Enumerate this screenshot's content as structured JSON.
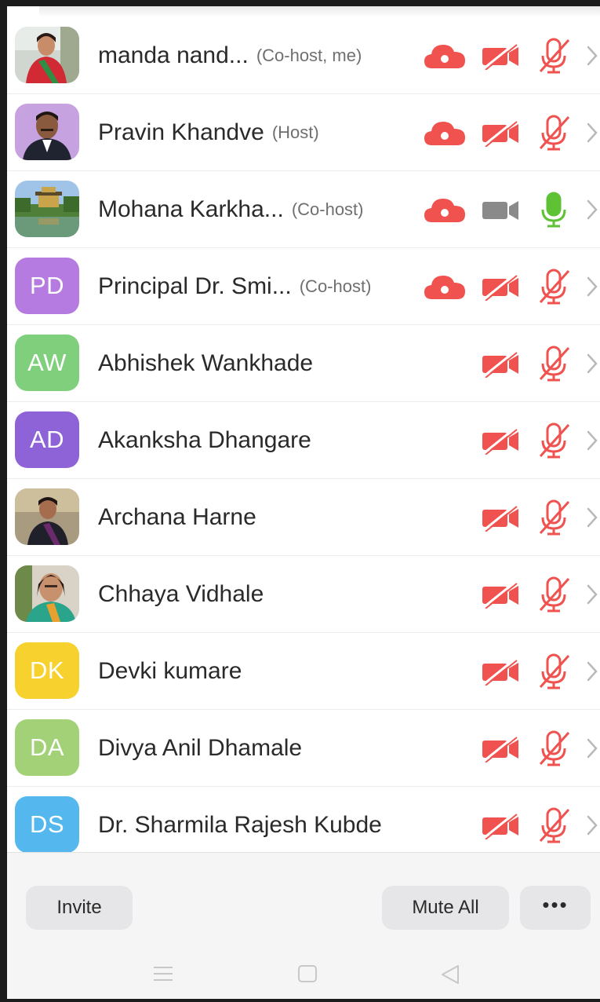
{
  "participants": [
    {
      "name": "manda nand...",
      "role": "(Co-host, me)",
      "avatar": {
        "type": "photo",
        "kind": "woman-red-saree"
      },
      "cloud": true,
      "video": "off",
      "mic": "muted"
    },
    {
      "name": "Pravin Khandve",
      "role": "(Host)",
      "avatar": {
        "type": "photo",
        "kind": "man-portrait"
      },
      "cloud": true,
      "video": "off",
      "mic": "muted"
    },
    {
      "name": "Mohana Karkha...",
      "role": "(Co-host)",
      "avatar": {
        "type": "photo",
        "kind": "temple-landscape"
      },
      "cloud": true,
      "video": "on-grey",
      "mic": "active"
    },
    {
      "name": "Principal Dr. Smi...",
      "role": "(Co-host)",
      "avatar": {
        "type": "initials",
        "text": "PD",
        "color": "#b57be0"
      },
      "cloud": true,
      "video": "off",
      "mic": "muted"
    },
    {
      "name": "Abhishek Wankhade",
      "role": "",
      "avatar": {
        "type": "initials",
        "text": "AW",
        "color": "#7fcf7c"
      },
      "cloud": false,
      "video": "off",
      "mic": "muted"
    },
    {
      "name": "Akanksha Dhangare",
      "role": "",
      "avatar": {
        "type": "initials",
        "text": "AD",
        "color": "#8e63d8"
      },
      "cloud": false,
      "video": "off",
      "mic": "muted"
    },
    {
      "name": "Archana Harne",
      "role": "",
      "avatar": {
        "type": "photo",
        "kind": "woman-dark-saree"
      },
      "cloud": false,
      "video": "off",
      "mic": "muted"
    },
    {
      "name": "Chhaya Vidhale",
      "role": "",
      "avatar": {
        "type": "photo",
        "kind": "woman-smiling"
      },
      "cloud": false,
      "video": "off",
      "mic": "muted"
    },
    {
      "name": "Devki kumare",
      "role": "",
      "avatar": {
        "type": "initials",
        "text": "DK",
        "color": "#f7d22e"
      },
      "cloud": false,
      "video": "off",
      "mic": "muted"
    },
    {
      "name": "Divya Anil Dhamale",
      "role": "",
      "avatar": {
        "type": "initials",
        "text": "DA",
        "color": "#a3d177"
      },
      "cloud": false,
      "video": "off",
      "mic": "muted"
    },
    {
      "name": "Dr. Sharmila Rajesh Kubde",
      "role": "",
      "avatar": {
        "type": "initials",
        "text": "DS",
        "color": "#54b8ee"
      },
      "cloud": false,
      "video": "off",
      "mic": "muted"
    }
  ],
  "actions": {
    "invite": "Invite",
    "mute_all": "Mute All",
    "more": "•••"
  },
  "colors": {
    "red": "#f0524f",
    "green": "#5fc235",
    "grey_icon": "#8a8a8a"
  },
  "system_nav": [
    "menu-icon",
    "home-icon",
    "back-icon"
  ]
}
